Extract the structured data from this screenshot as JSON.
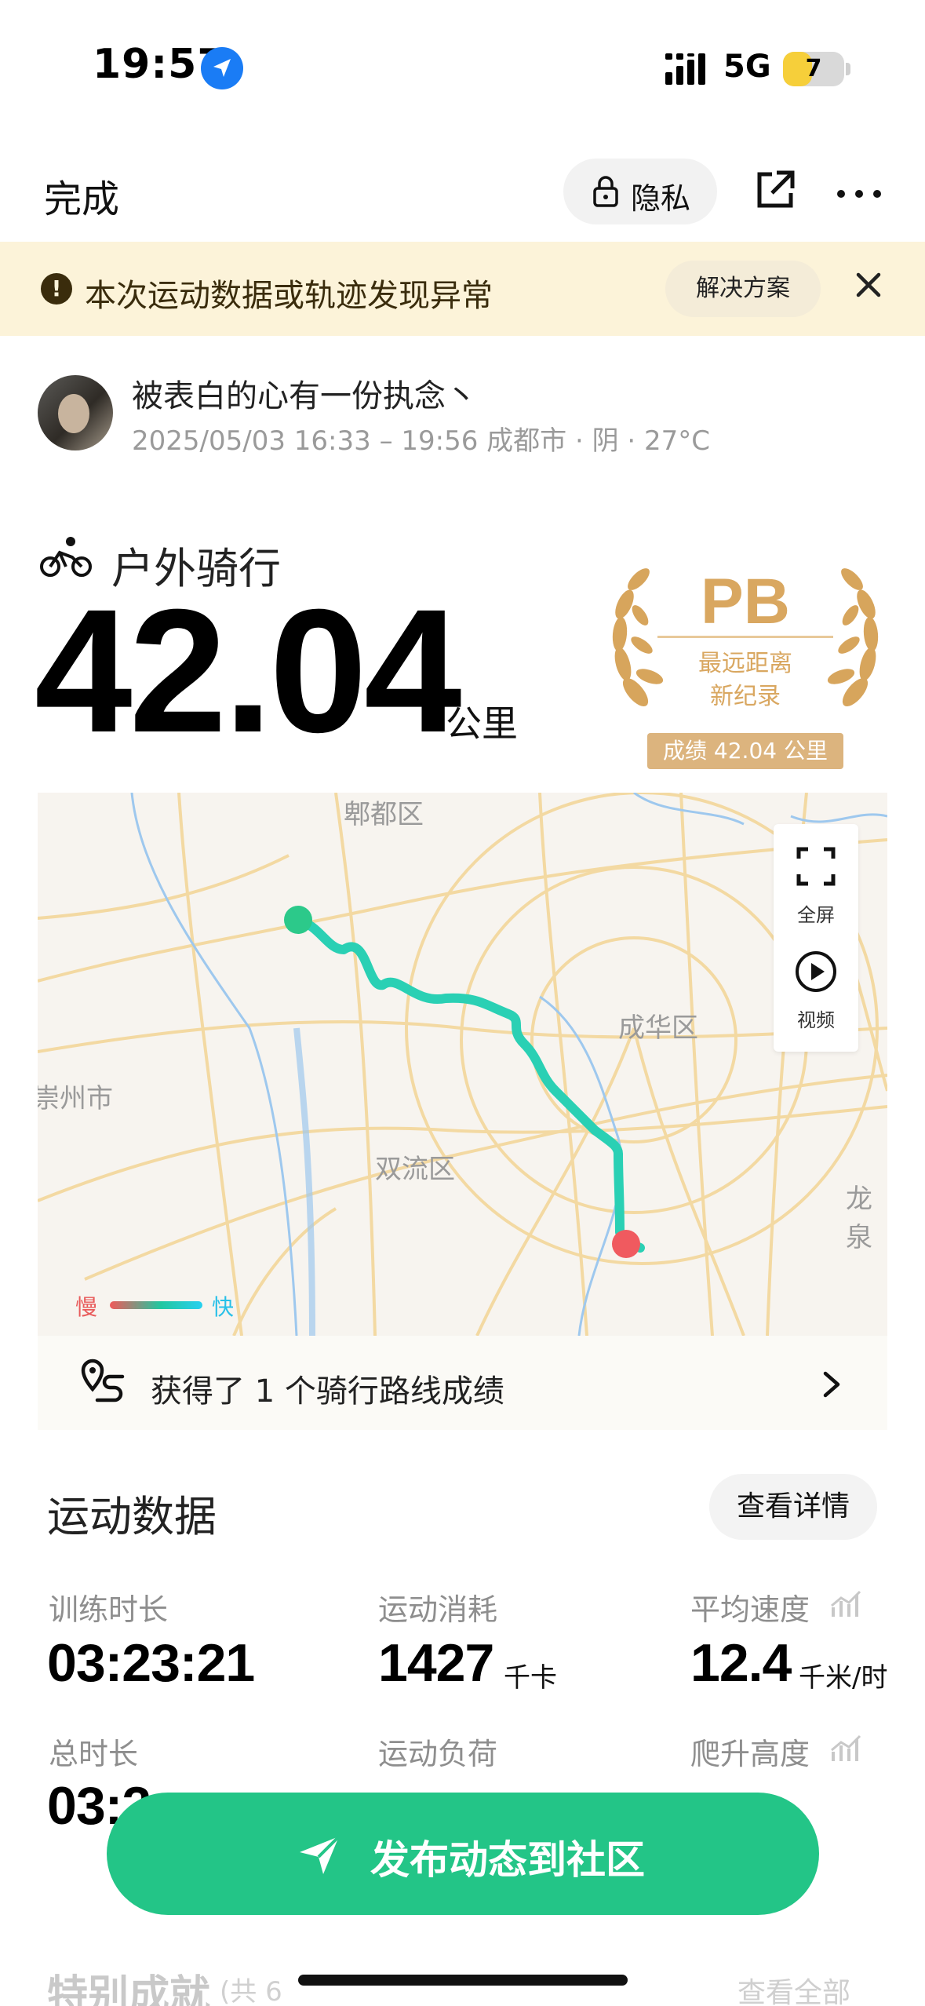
{
  "status_bar": {
    "time": "19:57",
    "network": "5G",
    "battery": "7",
    "battery_percent": 7
  },
  "header": {
    "done_label": "完成",
    "privacy_label": "隐私"
  },
  "warning": {
    "text": "本次运动数据或轨迹发现异常",
    "button_label": "解决方案"
  },
  "user": {
    "name": "被表白的心有一份执念丶",
    "meta": "2025/05/03 16:33 – 19:56 成都市 · 阴 · 27°C"
  },
  "activity": {
    "type": "户外骑行",
    "distance": "42.04",
    "distance_unit": "公里"
  },
  "pb_badge": {
    "title": "PB",
    "line1": "最远距离",
    "line2": "新纪录",
    "result": "成绩 42.04 公里"
  },
  "map": {
    "labels": {
      "pidu": "郫都区",
      "chenghua": "成华区",
      "chongzhou": "崇州市",
      "shuangliu": "双流区",
      "longquan": "龙泉"
    },
    "controls": {
      "fullscreen_label": "全屏",
      "video_label": "视频"
    },
    "legend": {
      "slow": "慢",
      "fast": "快"
    },
    "colors": {
      "start": "#2cc98a",
      "end": "#f05a5f",
      "track": "#2ad0b4"
    }
  },
  "route_achievement": {
    "text": "获得了 1 个骑行路线成绩"
  },
  "stats": {
    "title": "运动数据",
    "details_label": "查看详情",
    "items": [
      {
        "label": "训练时长",
        "value": "03:23:21",
        "unit": ""
      },
      {
        "label": "运动消耗",
        "value": "1427",
        "unit": "千卡"
      },
      {
        "label": "平均速度",
        "value": "12.4",
        "unit": "千米/时"
      },
      {
        "label": "总时长",
        "value": "03:2",
        "unit": ""
      },
      {
        "label": "运动负荷",
        "value": "",
        "unit": ""
      },
      {
        "label": "爬升高度",
        "value": "",
        "unit": ""
      }
    ]
  },
  "publish": {
    "label": "发布动态到社区"
  },
  "bottom": {
    "section_label": "特别成就",
    "section_count": "(共 6",
    "view_all": "查看全部"
  }
}
